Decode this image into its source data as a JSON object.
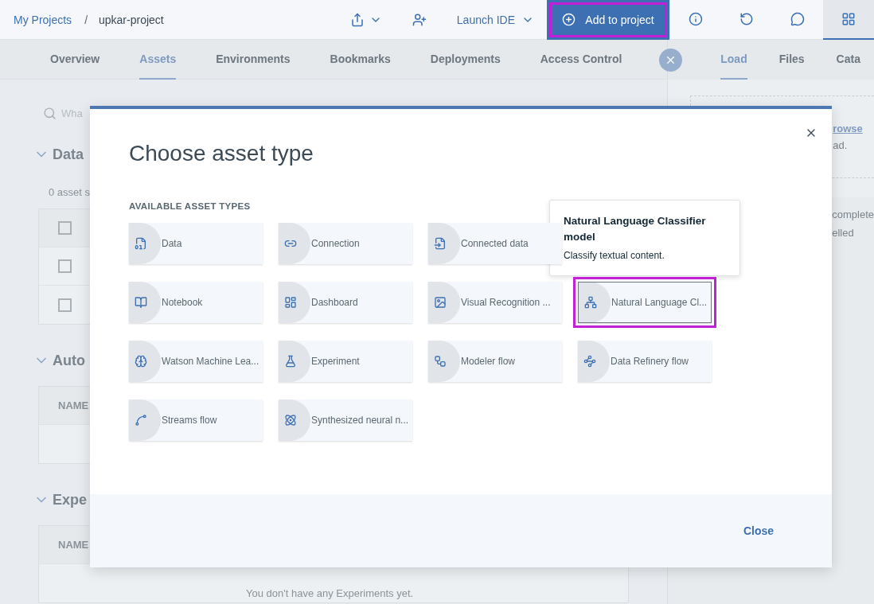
{
  "top_bar": {
    "breadcrumb": [
      {
        "label": "My Projects",
        "kind": "link"
      },
      {
        "label": "/",
        "kind": "separator"
      },
      {
        "label": "upkar-project",
        "kind": "current"
      }
    ],
    "launch_ide": "Launch IDE",
    "add_button": {
      "label": "Add to project",
      "highlighted": true
    },
    "panel_icons": [
      {
        "selected": false
      },
      {
        "selected": false
      },
      {
        "selected": false
      },
      {
        "selected": true
      }
    ]
  },
  "tabs": [
    {
      "label": "Overview",
      "selected": false
    },
    {
      "label": "Assets",
      "selected": true
    },
    {
      "label": "Environments",
      "selected": false
    },
    {
      "label": "Bookmarks",
      "selected": false
    },
    {
      "label": "Deployments",
      "selected": false
    },
    {
      "label": "Access Control",
      "selected": false
    }
  ],
  "background": {
    "search_placeholder": "Wha",
    "sections": [
      {
        "title": "Data",
        "note": "0 asset s",
        "kind": "checklist",
        "rows": [
          {
            "checked": false
          },
          {
            "checked": false
          },
          {
            "checked": false
          }
        ]
      },
      {
        "title": "Auto",
        "kind": "table",
        "column": "NAME"
      },
      {
        "title": "Expe",
        "kind": "table",
        "column": "NAME",
        "empty_text": "You don't have any Experiments yet."
      }
    ]
  },
  "side_panel": {
    "tabs": [
      {
        "label": "Load",
        "selected": true
      },
      {
        "label": "Files",
        "selected": false
      },
      {
        "label": "Cata",
        "selected": false
      }
    ],
    "drop_link": "rowse",
    "drop_text": "ad.",
    "status_lines": [
      "complete",
      "elled"
    ]
  },
  "modal": {
    "title": "Choose asset type",
    "section_label": "AVAILABLE ASSET TYPES",
    "asset_columns": [
      [
        {
          "label": "Data",
          "highlighted": false
        },
        {
          "label": "Notebook",
          "highlighted": false
        },
        {
          "label": "Watson Machine Lea...",
          "highlighted": false
        },
        {
          "label": "Streams flow",
          "highlighted": false
        }
      ],
      [
        {
          "label": "Connection",
          "highlighted": false
        },
        {
          "label": "Dashboard",
          "highlighted": false
        },
        {
          "label": "Experiment",
          "highlighted": false
        },
        {
          "label": "Synthesized neural n...",
          "highlighted": false
        }
      ],
      [
        {
          "label": "Connected data",
          "highlighted": false
        },
        {
          "label": "Visual Recognition ...",
          "highlighted": false
        },
        {
          "label": "Modeler flow",
          "highlighted": false
        }
      ],
      [
        {
          "label": "Natural Language Cl...",
          "highlighted": true
        },
        {
          "label": "Data Refinery flow",
          "highlighted": false
        }
      ]
    ],
    "tooltip": {
      "title": "Natural Language Classifier model",
      "text": "Classify textual content."
    },
    "footer_button": "Close"
  }
}
